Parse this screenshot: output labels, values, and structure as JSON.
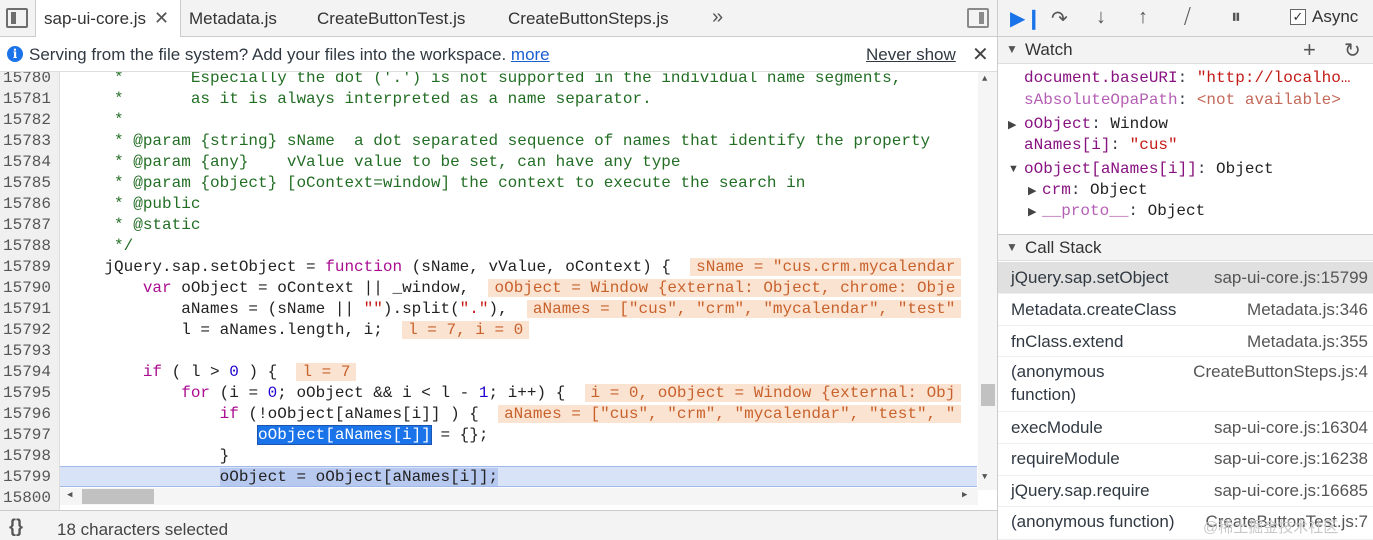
{
  "tabs": [
    {
      "label": "sap-ui-core.js",
      "active": true,
      "close": "✕"
    },
    {
      "label": "Metadata.js"
    },
    {
      "label": "CreateButtonTest.js"
    },
    {
      "label": "CreateButtonSteps.js"
    }
  ],
  "tab_more": "»",
  "infobar": {
    "message": "Serving from the file system? Add your files into the workspace.",
    "link": "more",
    "never_show": "Never show",
    "close": "✕"
  },
  "editor": {
    "line_numbers": [
      "15780",
      "15781",
      "15782",
      "15783",
      "15784",
      "15785",
      "15786",
      "15787",
      "15788",
      "15789",
      "15790",
      "15791",
      "15792",
      "15793",
      "15794",
      "15795",
      "15796",
      "15797",
      "15798",
      "15799",
      "15800"
    ]
  },
  "code": {
    "l15780": "     *       Especially the dot ('.') is not supported in the individual name segments,",
    "l15781": "     *       as it is always interpreted as a name separator.",
    "l15782": "     *",
    "l15783": "     * @param {string} sName  a dot separated sequence of names that identify the property",
    "l15784": "     * @param {any}    vValue value to be set, can have any type",
    "l15785": "     * @param {object} [oContext=window] the context to execute the search in",
    "l15786": "     * @public",
    "l15787": "     * @static",
    "l15788": "     */",
    "l15789_a": "    jQuery.sap.setObject = ",
    "l15789_kw": "function",
    "l15789_b": " (sName, vValue, oContext) {  ",
    "l15789_v": "sName = \"cus.crm.mycalendar",
    "l15790_pre": "        ",
    "l15790_kw": "var",
    "l15790_b": " oObject = oContext || _window,  ",
    "l15790_v": "oObject = Window {external: Object, chrome: Obje",
    "l15791_a": "            aNames = (sName || ",
    "l15791_s1": "\"\"",
    "l15791_b": ").split(",
    "l15791_s2": "\".\"",
    "l15791_c": "),  ",
    "l15791_v": "aNames = [\"cus\", \"crm\", \"mycalendar\", \"test\"",
    "l15792_a": "            l = aNames.length, i;  ",
    "l15792_v": "l = 7, i = 0",
    "l15794_pre": "        ",
    "l15794_kw": "if",
    "l15794_a": " ( l > ",
    "l15794_n": "0",
    "l15794_b": " ) {  ",
    "l15794_v": "l = 7",
    "l15795_pre": "            ",
    "l15795_kw": "for",
    "l15795_a": " (i = ",
    "l15795_n0": "0",
    "l15795_b": "; oObject && i < l - ",
    "l15795_n1": "1",
    "l15795_c": "; i++) {  ",
    "l15795_v": "i = 0, oObject = Window {external: Obj",
    "l15796_pre": "                ",
    "l15796_kw": "if",
    "l15796_a": " (!oObject[aNames[i]] ) {  ",
    "l15796_v": "aNames = [\"cus\", \"crm\", \"mycalendar\", \"test\", \"",
    "l15797_pre": "                    ",
    "l15797_sel": "oObject[aNames[i]]",
    "l15797_b": " = {};",
    "l15798": "                }",
    "l15799_pre": "                ",
    "l15799_sel": "oObject = oObject[aNames[i]];"
  },
  "status": {
    "braces": "{}",
    "text": "18 characters selected"
  },
  "debugger": {
    "async_label": "Async",
    "async_checked": true
  },
  "watch": {
    "title": "Watch",
    "items": [
      {
        "key": "document.baseURI",
        "value": "\"http://localho…"
      },
      {
        "key": "sAbsoluteOpaPath",
        "value": "<not available>"
      },
      {
        "key": "oObject",
        "value": "Window"
      },
      {
        "key": "aNames[i]",
        "value": "\"cus\""
      },
      {
        "key": "oObject[aNames[i]]",
        "value": "Object"
      },
      {
        "key": "crm",
        "value": "Object"
      },
      {
        "key": "__proto__",
        "value": "Object"
      }
    ]
  },
  "callstack": {
    "title": "Call Stack",
    "frames": [
      {
        "fn": "jQuery.sap.setObject",
        "loc": "sap-ui-core.js:15799"
      },
      {
        "fn": "Metadata.createClass",
        "loc": "Metadata.js:346"
      },
      {
        "fn": "fnClass.extend",
        "loc": "Metadata.js:355"
      },
      {
        "fn": "(anonymous",
        "fn2": "function)",
        "loc": "CreateButtonSteps.js:4"
      },
      {
        "fn": "execModule",
        "loc": "sap-ui-core.js:16304"
      },
      {
        "fn": "requireModule",
        "loc": "sap-ui-core.js:16238"
      },
      {
        "fn": "jQuery.sap.require",
        "loc": "sap-ui-core.js:16685"
      },
      {
        "fn": "(anonymous function)",
        "loc": "CreateButtonTest.js:7"
      }
    ]
  },
  "watermark": "@稀土掘金技术社区"
}
